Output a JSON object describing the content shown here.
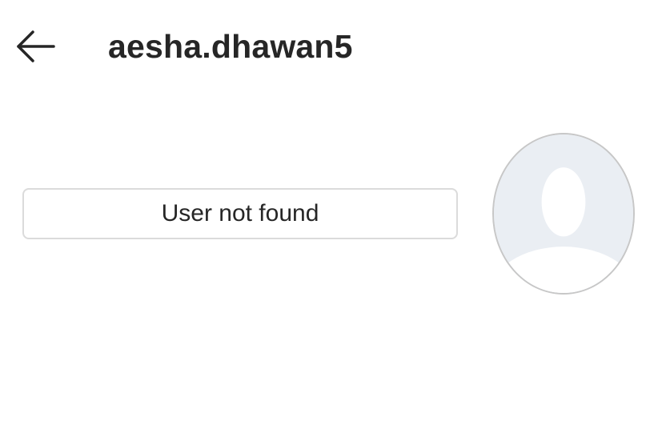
{
  "header": {
    "back_icon": "arrow-left-icon",
    "username": "aesha.dhawan5"
  },
  "profile": {
    "status_text": "User not found",
    "avatar_icon": "default-avatar-icon"
  },
  "colors": {
    "text": "#262626",
    "border": "#dbdbdb",
    "avatar_bg": "#eaeef3",
    "avatar_silhouette": "#ffffff"
  }
}
